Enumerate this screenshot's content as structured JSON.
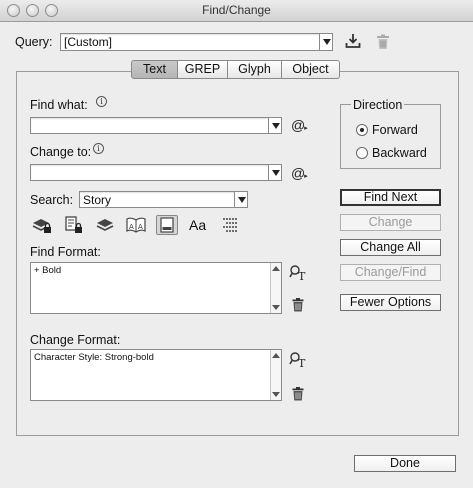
{
  "window": {
    "title": "Find/Change"
  },
  "query": {
    "label": "Query:",
    "value": "[Custom]"
  },
  "tabs": [
    {
      "label": "Text",
      "selected": true
    },
    {
      "label": "GREP",
      "selected": false
    },
    {
      "label": "Glyph",
      "selected": false
    },
    {
      "label": "Object",
      "selected": false
    }
  ],
  "find_what": {
    "label": "Find what:",
    "value": ""
  },
  "change_to": {
    "label": "Change to:",
    "value": ""
  },
  "search": {
    "label": "Search:",
    "value": "Story"
  },
  "direction": {
    "title": "Direction",
    "options": [
      {
        "label": "Forward",
        "checked": true
      },
      {
        "label": "Backward",
        "checked": false
      }
    ]
  },
  "buttons": {
    "find_next": "Find Next",
    "change": "Change",
    "change_all": "Change All",
    "change_find": "Change/Find",
    "fewer_options": "Fewer Options",
    "done": "Done"
  },
  "find_format": {
    "label": "Find Format:",
    "value": "+ Bold"
  },
  "change_format": {
    "label": "Change Format:",
    "value": "Character Style: Strong-bold"
  },
  "toolbar_icons": [
    "include-locked-layers-icon",
    "include-locked-stories-icon",
    "include-hidden-layers-icon",
    "include-master-pages-icon",
    "include-footnotes-icon",
    "case-sensitive-icon",
    "whole-word-icon"
  ],
  "case_sensitive_glyph": "Aa",
  "colors": {
    "window_bg": "#ededed",
    "border": "#8a8a8a"
  }
}
